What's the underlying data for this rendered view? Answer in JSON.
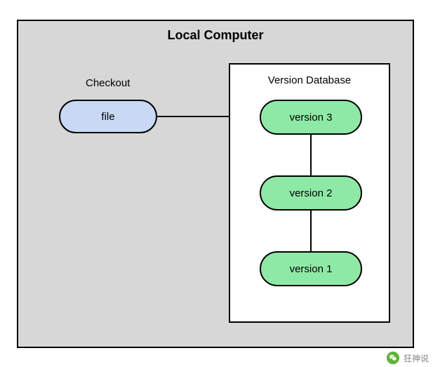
{
  "diagram": {
    "title": "Local Computer",
    "checkout": {
      "label": "Checkout",
      "file_label": "file"
    },
    "database": {
      "label": "Version Database",
      "versions": {
        "v3": "version 3",
        "v2": "version 2",
        "v1": "version 1"
      }
    }
  },
  "watermark": {
    "text": "狂神说"
  }
}
